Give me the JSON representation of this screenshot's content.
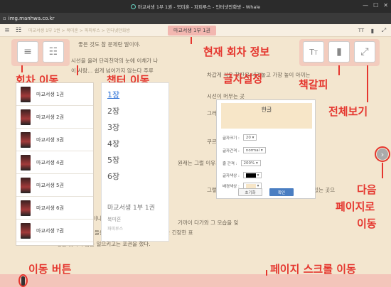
{
  "window": {
    "title": "마교서생 1부 1권 - 북미혼 - 파피루스 - 인터넷만화방 - Whale"
  },
  "url": {
    "host": "img.manhwa.co.kr"
  },
  "toolbar": {
    "breadcrumb": "마교서생 1부 1권 > 북미혼 > 파피루스 > 인터넷만화방",
    "current_chapter": "마교서생 1부 1권"
  },
  "content_lines": [
    "좋은 것도 참 문제란 말이야.",
    "시선을 올려 단리천악의 눈에 이채가 나",
    "이 사람... 쉽게 넘어가지 않는다 주루",
    "차갑게 식은 찻잔을 내려놓고 가장 높이 아끼는",
    "시선이 머무는 곳",
    "그러나 그대로였다.",
    "쿠르릉.",
    "원래는 그럴 이유가 없었다 이곳",
    "그렇게 말했다. 지켜보던 한 사람이 있었다 앉아 있는 곳으",
    "가까이 다가와 그 모습을 잊",
    "\"어디서 온 자들이냐?\"",
    "술을 마시면 무인들은 정탐꾼의 무인들을 보자 약간 긴장한 표",
    "정을 짓더니 몸을 일으키고는 포권을 했다."
  ],
  "annotations": {
    "chapter_info": "현재 회차 정보",
    "episode_move": "회차 이동",
    "chapter_move": "챕터 이동",
    "font_settings": "글자설정",
    "bookmark": "책갈피",
    "fullscreen": "전체보기",
    "next_page_1": "다음",
    "next_page_2": "페이지로",
    "next_page_3": "이동",
    "move_button": "이동 버튼",
    "page_scroll": "페이지 스크롤 이동"
  },
  "episodes": [
    {
      "label": "마교서생 1권"
    },
    {
      "label": "마교서생 2권"
    },
    {
      "label": "마교서생 3권"
    },
    {
      "label": "마교서생 4권"
    },
    {
      "label": "마교서생 5권"
    },
    {
      "label": "마교서생 6권"
    },
    {
      "label": "마교서생 7권"
    }
  ],
  "sections": {
    "items": [
      "1장",
      "2장",
      "3장",
      "4장",
      "5장",
      "6장"
    ],
    "book_title": "마교서생 1부 1권",
    "author": "북미혼",
    "publisher": "파피루스"
  },
  "font_panel": {
    "preview": "한글",
    "size_label": "글자크기 :",
    "size_value": "20",
    "spacing_label": "글자간격 :",
    "spacing_value": "normal",
    "line_label": "줄 간격 :",
    "line_value": "200%",
    "color_label": "글자색상 :",
    "bg_label": "배경색상 :",
    "reset_label": "초기화",
    "ok_label": "확인",
    "text_color": "#000000",
    "bg_color": "#f7e6c8"
  },
  "colors": {
    "accent": "#e5362e",
    "highlight": "#f2b7b0"
  }
}
